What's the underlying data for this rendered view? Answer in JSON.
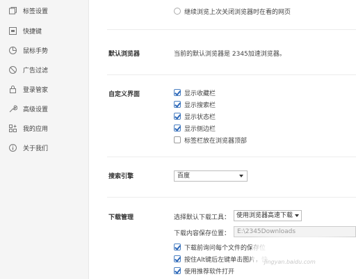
{
  "sidebar": {
    "items": [
      {
        "label": "标签设置",
        "icon": "tabs-icon"
      },
      {
        "label": "快捷键",
        "icon": "keyboard-icon"
      },
      {
        "label": "鼠标手势",
        "icon": "mouse-icon"
      },
      {
        "label": "广告过滤",
        "icon": "block-icon"
      },
      {
        "label": "登录管家",
        "icon": "lock-icon"
      },
      {
        "label": "高级设置",
        "icon": "wrench-icon"
      },
      {
        "label": "我的应用",
        "icon": "apps-icon"
      },
      {
        "label": "关于我们",
        "icon": "info-icon"
      }
    ]
  },
  "startup": {
    "resume_option": "继续浏览上次关闭浏览器时在看的网页"
  },
  "default_browser": {
    "title": "默认浏览器",
    "status": "当前的默认浏览器是 2345加速浏览器。"
  },
  "custom_ui": {
    "title": "自定义界面",
    "options": [
      {
        "label": "显示收藏栏",
        "checked": true
      },
      {
        "label": "显示搜索栏",
        "checked": true
      },
      {
        "label": "显示状态栏",
        "checked": true
      },
      {
        "label": "显示侧边栏",
        "checked": true
      },
      {
        "label": "标签栏放在浏览器顶部",
        "checked": false
      }
    ]
  },
  "search_engine": {
    "title": "搜索引擎",
    "selected": "百度"
  },
  "download": {
    "title": "下载管理",
    "tool_label": "选择默认下载工具：",
    "tool_selected": "使用浏览器高速下载",
    "path_label": "下载内容保存位置：",
    "path_value": "E:\\2345Downloads",
    "options": [
      {
        "label": "下载前询问每个文件的保存位",
        "checked": true
      },
      {
        "label": "按住Alt键后左键单击图片，快",
        "checked": true
      },
      {
        "label": "使用推荐软件打开",
        "checked": true
      }
    ]
  },
  "watermark": {
    "text": "jingyan.baidu.com"
  }
}
